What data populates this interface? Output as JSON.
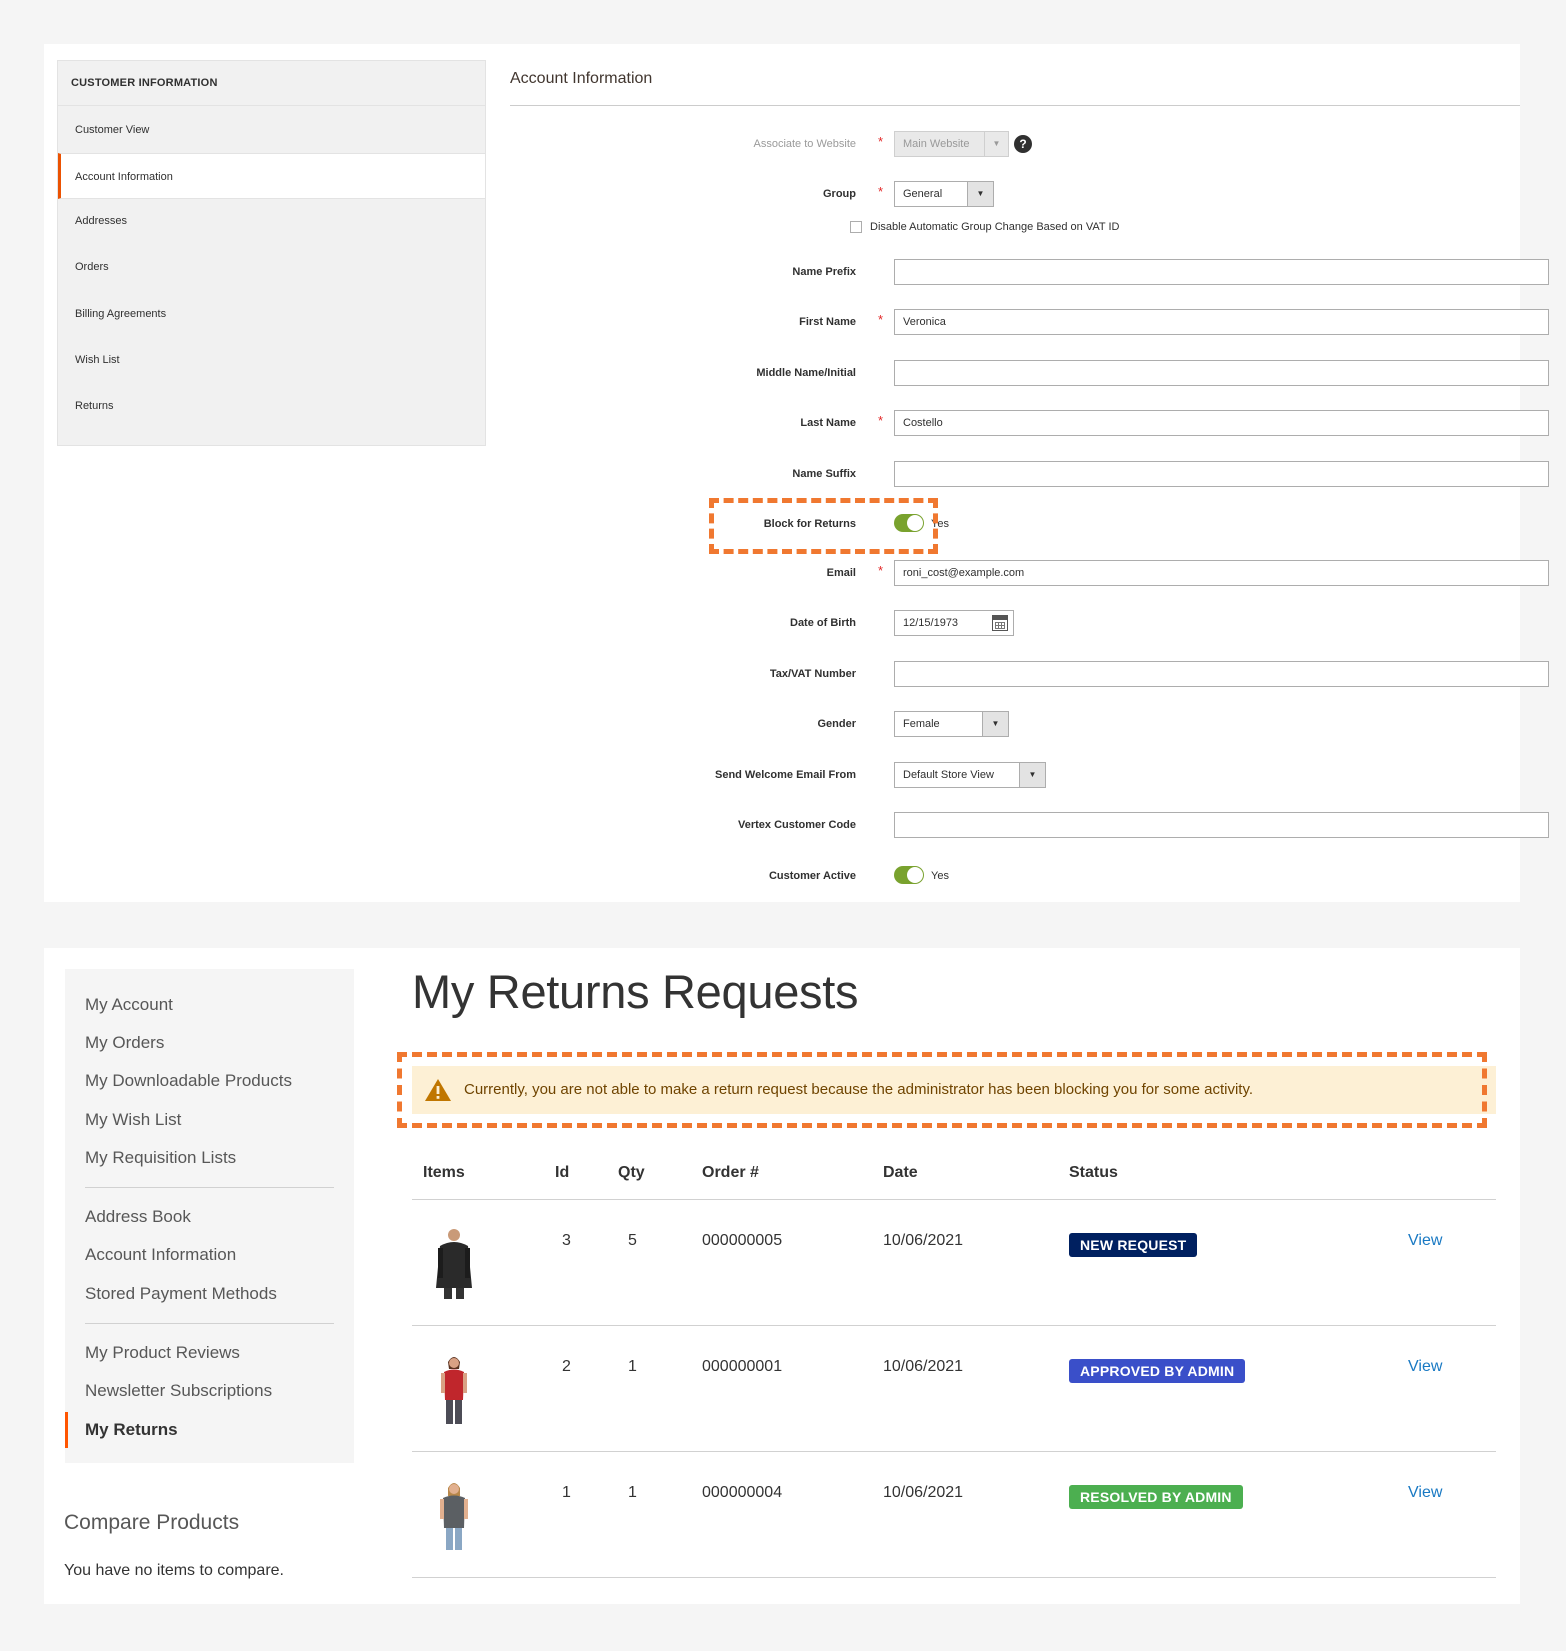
{
  "admin": {
    "sidebar": {
      "title": "CUSTOMER INFORMATION",
      "items": [
        "Customer View",
        "Account Information",
        "Addresses",
        "Orders",
        "Billing Agreements",
        "Wish List",
        "Returns"
      ],
      "active_index": 1
    },
    "section_title": "Account Information",
    "fields": {
      "website": {
        "label": "Associate to Website",
        "value": "Main Website",
        "required": "*"
      },
      "group": {
        "label": "Group",
        "value": "General",
        "required": "*"
      },
      "vat_checkbox_label": "Disable Automatic Group Change Based on VAT ID",
      "name_prefix": {
        "label": "Name Prefix",
        "value": ""
      },
      "first_name": {
        "label": "First Name",
        "value": "Veronica",
        "required": "*"
      },
      "middle_name": {
        "label": "Middle Name/Initial",
        "value": ""
      },
      "last_name": {
        "label": "Last Name",
        "value": "Costello",
        "required": "*"
      },
      "name_suffix": {
        "label": "Name Suffix",
        "value": ""
      },
      "block_returns": {
        "label": "Block for Returns",
        "value": "Yes"
      },
      "email": {
        "label": "Email",
        "value": "roni_cost@example.com",
        "required": "*"
      },
      "dob": {
        "label": "Date of Birth",
        "value": "12/15/1973"
      },
      "taxvat": {
        "label": "Tax/VAT Number",
        "value": ""
      },
      "gender": {
        "label": "Gender",
        "value": "Female"
      },
      "welcome_email": {
        "label": "Send Welcome Email From",
        "value": "Default Store View"
      },
      "vertex_code": {
        "label": "Vertex Customer Code",
        "value": ""
      },
      "customer_active": {
        "label": "Customer Active",
        "value": "Yes"
      }
    },
    "help_icon_glyph": "?"
  },
  "store": {
    "sidebar": {
      "group1": [
        "My Account",
        "My Orders",
        "My Downloadable Products",
        "My Wish List",
        "My Requisition Lists"
      ],
      "group2": [
        "Address Book",
        "Account Information",
        "Stored Payment Methods"
      ],
      "group3": [
        "My Product Reviews",
        "Newsletter Subscriptions"
      ],
      "active": "My Returns"
    },
    "compare": {
      "title": "Compare Products",
      "text": "You have no items to compare."
    },
    "page_title": "My Returns Requests",
    "message": "Currently, you are not able to make a return request because the administrator has been blocking you for some activity.",
    "table": {
      "headers": {
        "items": "Items",
        "id": "Id",
        "qty": "Qty",
        "order": "Order #",
        "date": "Date",
        "status": "Status"
      },
      "rows": [
        {
          "id": "3",
          "qty": "5",
          "order": "000000005",
          "date": "10/06/2021",
          "status": "NEW REQUEST",
          "status_color": "#002060",
          "link": "View",
          "thumb": "jacket-thumbnail"
        },
        {
          "id": "2",
          "qty": "1",
          "order": "000000001",
          "date": "10/06/2021",
          "status": "APPROVED BY ADMIN",
          "status_color": "#3a4fc9",
          "link": "View",
          "thumb": "red-top-thumbnail"
        },
        {
          "id": "1",
          "qty": "1",
          "order": "000000004",
          "date": "10/06/2021",
          "status": "RESOLVED BY ADMIN",
          "status_color": "#4caf50",
          "link": "View",
          "thumb": "grey-tee-thumbnail"
        }
      ]
    }
  },
  "colors": {
    "highlight": "#f07830",
    "admin_accent": "#eb5202",
    "toggle_on": "#79a22e",
    "link": "#1979c3",
    "warning_bg": "#fdf0d5"
  }
}
